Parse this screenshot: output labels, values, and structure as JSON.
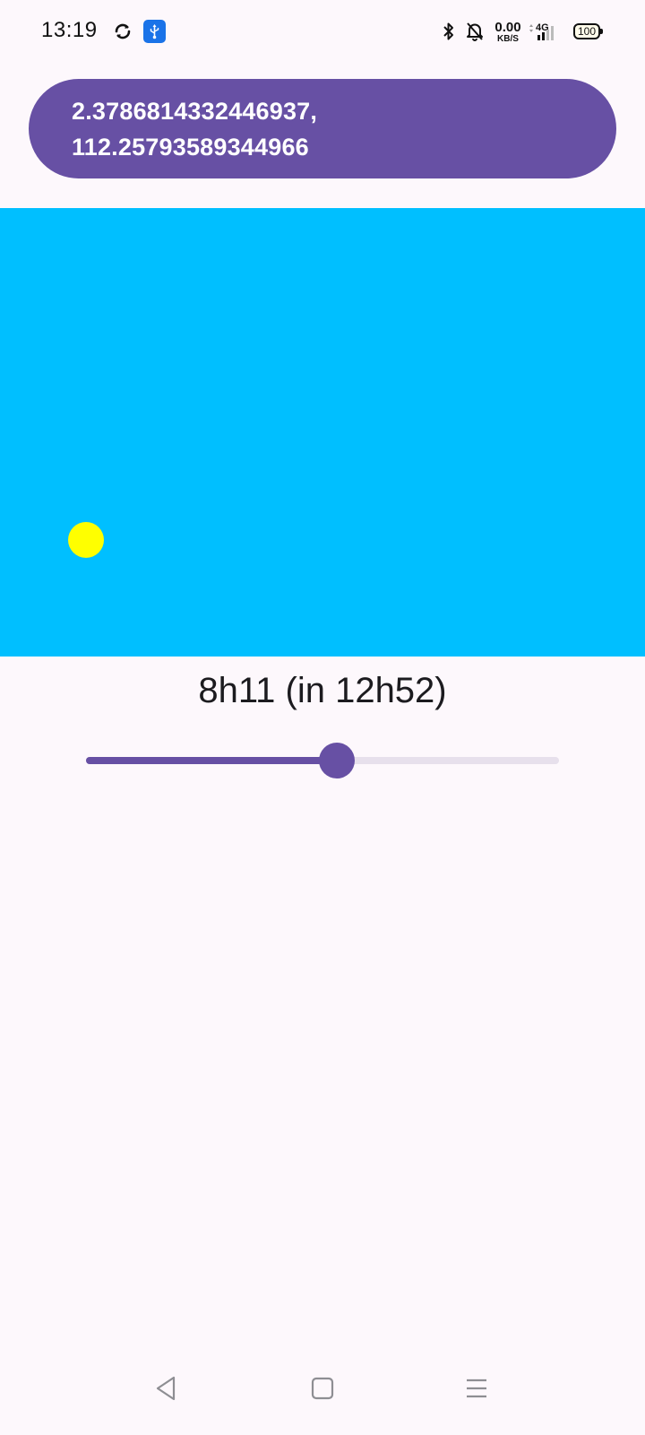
{
  "status_bar": {
    "time": "13:19",
    "icons": [
      "sync-icon",
      "usb-icon",
      "bluetooth-icon",
      "bell-muted-icon",
      "signal-4g-icon",
      "battery-icon"
    ],
    "net_speed_value": "0.00",
    "net_speed_unit": "KB/S",
    "network_type": "4G",
    "battery_level": "100"
  },
  "coordinates": {
    "latitude_line": "2.3786814332446937,",
    "longitude_line": "112.25793589344966"
  },
  "sky": {
    "sky_color": "#00bfff",
    "sun_color": "#ffff00"
  },
  "time_label": "8h11 (in 12h52)",
  "slider": {
    "value_fraction": 0.53,
    "accent_color": "#6750a4",
    "track_color": "#e7e0ec"
  },
  "nav_bar": {
    "icons": [
      "back-icon",
      "home-icon",
      "recents-icon"
    ]
  }
}
